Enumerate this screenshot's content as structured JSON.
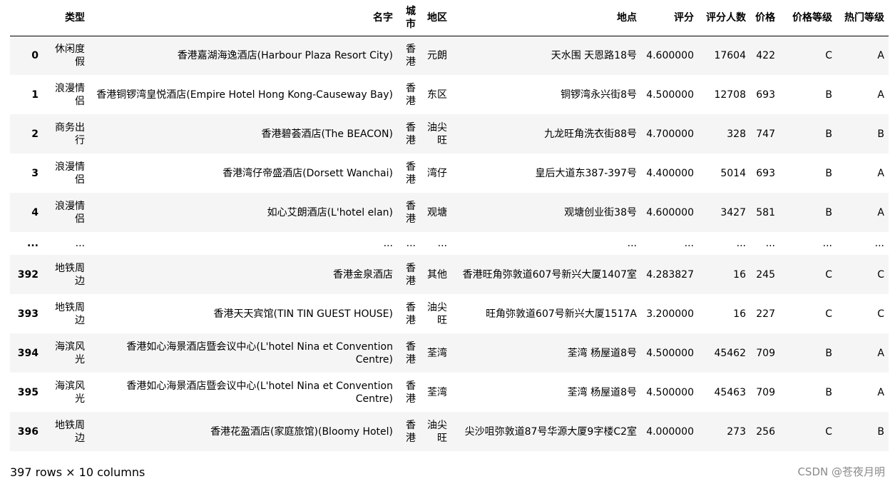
{
  "table": {
    "columns": [
      "类型",
      "名字",
      "城市",
      "地区",
      "地点",
      "评分",
      "评分人数",
      "价格",
      "价格等级",
      "热门等级"
    ],
    "rows": [
      {
        "index": "0",
        "cells": [
          "休闲度假",
          "香港嘉湖海逸酒店(Harbour Plaza Resort City)",
          "香港",
          "元朗",
          "天水围 天恩路18号",
          "4.600000",
          "17604",
          "422",
          "C",
          "A"
        ]
      },
      {
        "index": "1",
        "cells": [
          "浪漫情侣",
          "香港铜锣湾皇悦酒店(Empire Hotel Hong Kong-Causeway Bay)",
          "香港",
          "东区",
          "铜锣湾永兴街8号",
          "4.500000",
          "12708",
          "693",
          "B",
          "A"
        ]
      },
      {
        "index": "2",
        "cells": [
          "商务出行",
          "香港碧荟酒店(The BEACON)",
          "香港",
          "油尖旺",
          "九龙旺角洗衣街88号",
          "4.700000",
          "328",
          "747",
          "B",
          "B"
        ]
      },
      {
        "index": "3",
        "cells": [
          "浪漫情侣",
          "香港湾仔帝盛酒店(Dorsett Wanchai)",
          "香港",
          "湾仔",
          "皇后大道东387-397号",
          "4.400000",
          "5014",
          "693",
          "B",
          "A"
        ]
      },
      {
        "index": "4",
        "cells": [
          "浪漫情侣",
          "如心艾朗酒店(L'hotel elan)",
          "香港",
          "观塘",
          "观塘创业街38号",
          "4.600000",
          "3427",
          "581",
          "B",
          "A"
        ]
      },
      {
        "index": "...",
        "cells": [
          "...",
          "...",
          "...",
          "...",
          "...",
          "...",
          "...",
          "...",
          "...",
          "..."
        ]
      },
      {
        "index": "392",
        "cells": [
          "地铁周边",
          "香港金泉酒店",
          "香港",
          "其他",
          "香港旺角弥敦道607号新兴大厦1407室",
          "4.283827",
          "16",
          "245",
          "C",
          "C"
        ]
      },
      {
        "index": "393",
        "cells": [
          "地铁周边",
          "香港天天宾馆(TIN TIN GUEST HOUSE)",
          "香港",
          "油尖旺",
          "旺角弥敦道607号新兴大厦1517A",
          "3.200000",
          "16",
          "227",
          "C",
          "C"
        ]
      },
      {
        "index": "394",
        "cells": [
          "海滨风光",
          "香港如心海景酒店暨会议中心(L'hotel Nina et Convention Centre)",
          "香港",
          "荃湾",
          "荃湾 杨屋道8号",
          "4.500000",
          "45462",
          "709",
          "B",
          "A"
        ]
      },
      {
        "index": "395",
        "cells": [
          "海滨风光",
          "香港如心海景酒店暨会议中心(L'hotel Nina et Convention Centre)",
          "香港",
          "荃湾",
          "荃湾 杨屋道8号",
          "4.500000",
          "45463",
          "709",
          "B",
          "A"
        ]
      },
      {
        "index": "396",
        "cells": [
          "地铁周边",
          "香港花盈酒店(家庭旅馆)(Bloomy Hotel)",
          "香港",
          "油尖旺",
          "尖沙咀弥敦道87号华源大厦9字楼C2室",
          "4.000000",
          "273",
          "256",
          "C",
          "B"
        ]
      }
    ]
  },
  "footer": "397 rows × 10 columns",
  "watermark": "CSDN @苍夜月明"
}
